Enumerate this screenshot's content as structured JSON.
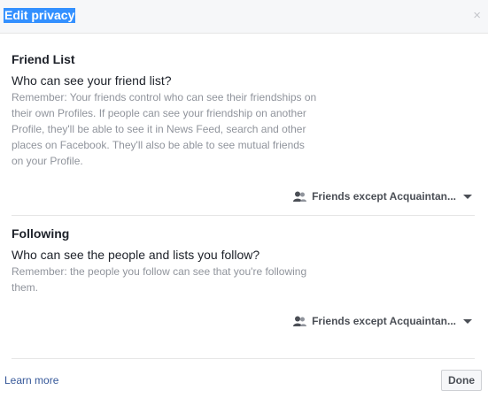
{
  "dialog": {
    "title": "Edit privacy",
    "close_glyph": "×"
  },
  "sections": [
    {
      "heading": "Friend List",
      "question": "Who can see your friend list?",
      "note": "Remember: Your friends control who can see their friendships on their own Profiles. If people can see your friendship on another Profile, they'll be able to see it in News Feed, search and other places on Facebook. They'll also be able to see mutual friends on your Profile.",
      "audience": "Friends except Acquaintan...",
      "audience_icon": "people-icon"
    },
    {
      "heading": "Following",
      "question": "Who can see the people and lists you follow?",
      "note": "Remember: the people you follow can see that you're following them.",
      "audience": "Friends except Acquaintan...",
      "audience_icon": "people-icon"
    }
  ],
  "footer": {
    "learn_more": "Learn more",
    "done": "Done"
  },
  "colors": {
    "link": "#365899",
    "title_highlight": "#3390ff",
    "muted_text": "#90949c"
  }
}
